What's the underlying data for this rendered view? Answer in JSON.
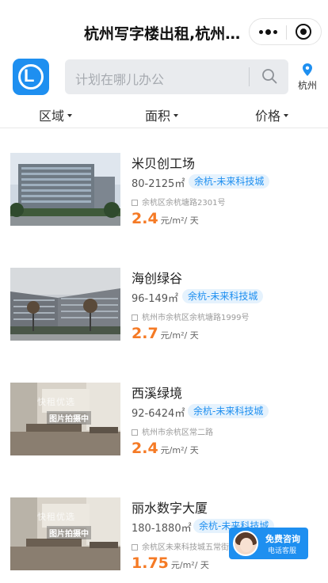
{
  "header": {
    "title": "杭州写字楼出租,杭州办公室出租",
    "more_icon": "more-dots-icon",
    "close_icon": "target-circle-icon"
  },
  "search": {
    "placeholder": "计划在哪儿办公",
    "icon": "search-icon"
  },
  "location": {
    "city": "杭州",
    "icon": "location-pin-icon"
  },
  "filters": [
    {
      "label": "区域"
    },
    {
      "label": "面积"
    },
    {
      "label": "价格"
    }
  ],
  "listings": [
    {
      "name": "米贝创工场",
      "area": "80-2125㎡",
      "tag": "余杭-未来科技城",
      "address": "余杭区余杭塘路2301号",
      "price": "2.4",
      "unit": "元/m²/ 天"
    },
    {
      "name": "海创绿谷",
      "area": "96-149㎡",
      "tag": "余杭-未来科技城",
      "address": "杭州市余杭区余杭塘路1999号",
      "price": "2.7",
      "unit": "元/m²/ 天"
    },
    {
      "name": "西溪绿境",
      "area": "92-6424㎡",
      "tag": "余杭-未来科技城",
      "address": "杭州市余杭区常二路",
      "price": "2.4",
      "unit": "元/m²/ 天"
    },
    {
      "name": "丽水数字大厦",
      "area": "180-1880㎡",
      "tag": "余杭-未来科技城",
      "address": "余杭区未来科技城五常街道",
      "price": "1.75",
      "unit": "元/m²/ 天"
    }
  ],
  "placeholder_image": {
    "line1": "快租优选",
    "line2": "图片拍摄中"
  },
  "consult": {
    "title": "免费咨询",
    "subtitle": "电话客服"
  },
  "colors": {
    "brand": "#1e8ff0",
    "price": "#f57a25"
  }
}
